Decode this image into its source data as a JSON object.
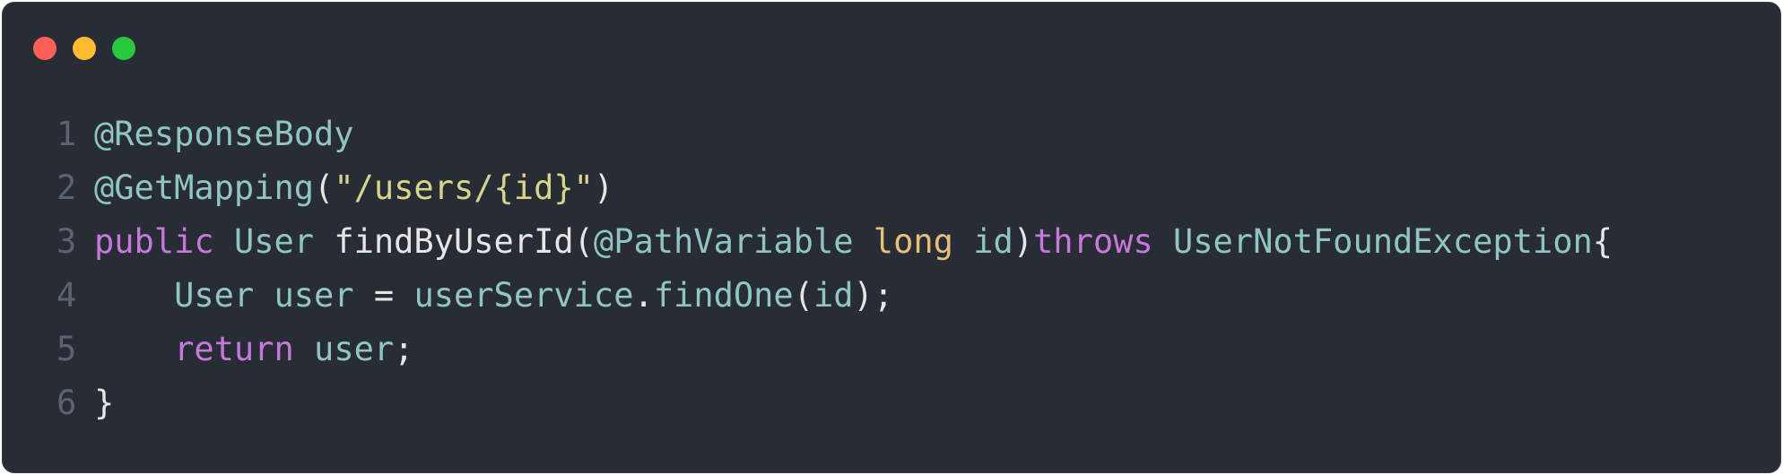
{
  "window": {
    "controls": [
      {
        "name": "close",
        "color": "#ff5f56"
      },
      {
        "name": "minimize",
        "color": "#ffbd2e"
      },
      {
        "name": "maximize",
        "color": "#27c93f"
      }
    ]
  },
  "colors": {
    "background": "#282c34",
    "line_number": "#5c6370",
    "annotation": "#8fc6c0",
    "keyword": "#c678dd",
    "type": "#8fc6c0",
    "plain": "#e6e6e6",
    "string": "#d6d68a",
    "primitive": "#e5c07b",
    "identifier": "#8fc6c0"
  },
  "code": {
    "lines": [
      {
        "number": "1",
        "tokens": [
          {
            "text": "@ResponseBody",
            "kind": "annotation"
          }
        ]
      },
      {
        "number": "2",
        "tokens": [
          {
            "text": "@GetMapping",
            "kind": "annotation"
          },
          {
            "text": "(",
            "kind": "plain"
          },
          {
            "text": "\"/users/{id}\"",
            "kind": "string"
          },
          {
            "text": ")",
            "kind": "plain"
          }
        ]
      },
      {
        "number": "3",
        "tokens": [
          {
            "text": "public",
            "kind": "keyword"
          },
          {
            "text": " ",
            "kind": "plain"
          },
          {
            "text": "User",
            "kind": "type"
          },
          {
            "text": " findByUserId(",
            "kind": "plain"
          },
          {
            "text": "@PathVariable",
            "kind": "annotation"
          },
          {
            "text": " ",
            "kind": "plain"
          },
          {
            "text": "long",
            "kind": "primitive"
          },
          {
            "text": " ",
            "kind": "plain"
          },
          {
            "text": "id",
            "kind": "identifier"
          },
          {
            "text": ")",
            "kind": "plain"
          },
          {
            "text": "throws",
            "kind": "keyword"
          },
          {
            "text": " ",
            "kind": "plain"
          },
          {
            "text": "UserNotFoundException",
            "kind": "type"
          },
          {
            "text": "{",
            "kind": "plain"
          }
        ]
      },
      {
        "number": "4",
        "tokens": [
          {
            "text": "    ",
            "kind": "plain"
          },
          {
            "text": "User",
            "kind": "type"
          },
          {
            "text": " ",
            "kind": "plain"
          },
          {
            "text": "user",
            "kind": "identifier"
          },
          {
            "text": " = ",
            "kind": "plain"
          },
          {
            "text": "userService",
            "kind": "identifier"
          },
          {
            "text": ".",
            "kind": "plain"
          },
          {
            "text": "findOne",
            "kind": "identifier"
          },
          {
            "text": "(",
            "kind": "plain"
          },
          {
            "text": "id",
            "kind": "identifier"
          },
          {
            "text": ");",
            "kind": "plain"
          }
        ]
      },
      {
        "number": "5",
        "tokens": [
          {
            "text": "    ",
            "kind": "plain"
          },
          {
            "text": "return",
            "kind": "keyword"
          },
          {
            "text": " ",
            "kind": "plain"
          },
          {
            "text": "user",
            "kind": "identifier"
          },
          {
            "text": ";",
            "kind": "plain"
          }
        ]
      },
      {
        "number": "6",
        "tokens": [
          {
            "text": "}",
            "kind": "plain"
          }
        ]
      }
    ]
  }
}
